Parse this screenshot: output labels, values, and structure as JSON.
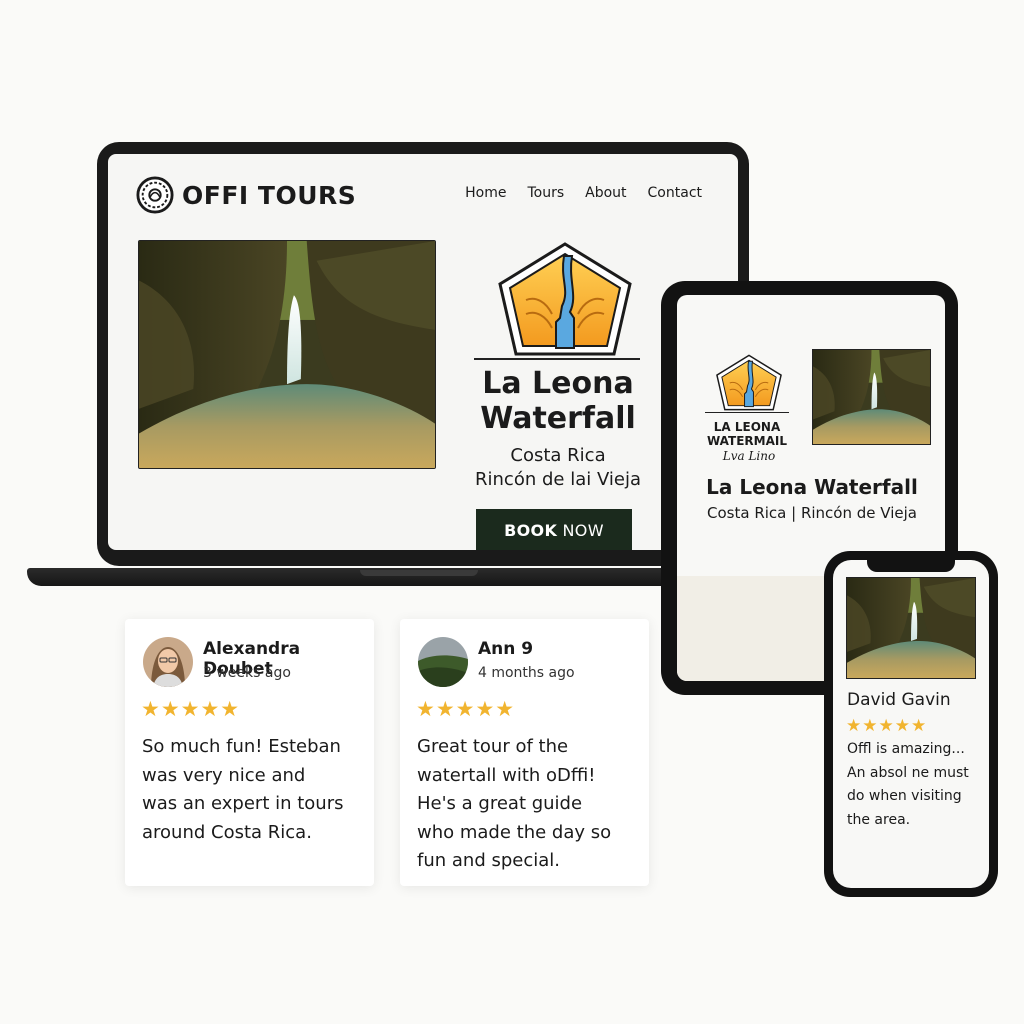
{
  "colors": {
    "accent_dark": "#1b2a1d",
    "star": "#f1b42f",
    "logo_orange": "#f6a623",
    "logo_blue": "#5aa8e0"
  },
  "laptop": {
    "brand": "OFFI TOURS",
    "nav": [
      "Home",
      "Tours",
      "About",
      "Contact"
    ],
    "hero_title_line1": "La Leona",
    "hero_title_line2": "Waterfall",
    "hero_sub_line1": "Costa Rica",
    "hero_sub_line2": "Rincón de lai Vieja",
    "book_label_bold": "BOOK",
    "book_label_rest": " NOW"
  },
  "tablet": {
    "logo_text_line1": "LA LEONA",
    "logo_text_line2": "WATERMAIL",
    "logo_text_line3": "Lva Lino",
    "title": "La Leona Waterfall",
    "subtitle": "Costa Rica | Rincón de Vieja"
  },
  "phone": {
    "reviewer": "David Gavin",
    "stars": "★★★★★",
    "text_lines": [
      "Offl is amazing...",
      "An absol ne must",
      "do when visiting",
      "the area."
    ]
  },
  "reviews": [
    {
      "name": "Alexandra Doubet",
      "date": "3 weeks ago",
      "stars": "★★★★★",
      "text_lines": [
        "So much fun! Esteban",
        "was very nice and",
        "was an expert in tours",
        "around Costa Rica."
      ]
    },
    {
      "name": "Ann 9",
      "date": "4 months ago",
      "stars": "★★★★★",
      "text_lines": [
        "Great tour of the",
        "watertall with oDffi!",
        "He's a great guide",
        "who made the day so",
        "fun and special."
      ]
    }
  ]
}
